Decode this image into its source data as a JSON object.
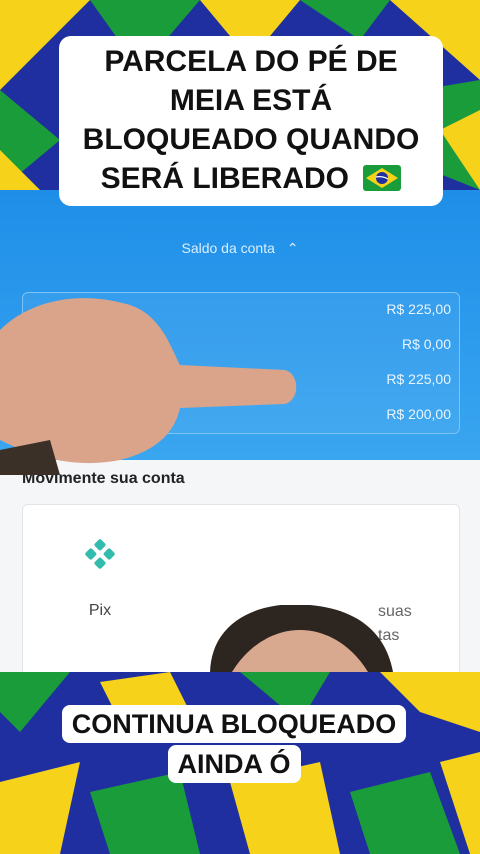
{
  "captions": {
    "top_line1": "PARCELA DO PÉ DE",
    "top_line2": "MEIA ESTÁ",
    "top_line3": "BLOQUEADO QUANDO",
    "top_line4": "SERÁ LIBERADO",
    "bottom_line1": "CONTINUA BLOQUEADO",
    "bottom_line2": "AINDA Ó"
  },
  "app": {
    "saldo_label": "Saldo da conta",
    "saldo_values": [
      "R$ 225,00",
      "R$ 0,00",
      "R$ 225,00",
      "R$ 200,00"
    ],
    "section_title": "Movimente sua conta",
    "actions": {
      "pix": "Pix",
      "other_line1": "suas",
      "other_line2": "tas"
    }
  },
  "colors": {
    "flag_green": "#1a9c3a",
    "flag_yellow": "#f6d21a",
    "flag_blue": "#1f2fa0",
    "app_blue": "#1e8ee8",
    "pix_teal": "#32bcad"
  },
  "icons": {
    "chevron": "chevron-up-icon",
    "pix": "pix-icon",
    "flag": "brazil-flag-icon"
  }
}
